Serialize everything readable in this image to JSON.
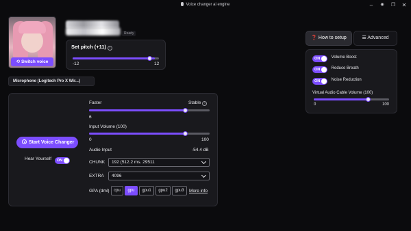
{
  "window": {
    "title": "Voice changer ai engine"
  },
  "avatar": {
    "switch_label": "Switch voice"
  },
  "voice": {
    "status": "Ready"
  },
  "pitch": {
    "label": "Set pitch (+11)",
    "min": "-12",
    "max": "12",
    "value": 11
  },
  "microphone": {
    "value": "Microphone (Logitech Pro X Wir...)"
  },
  "main": {
    "start_label": "Start Voice Changer",
    "hear_yourself_label": "Hear Yourself",
    "hear_yourself_toggle": "ON",
    "faster_label": "Faster",
    "stable_label": "Stable",
    "speed_value": "6",
    "speed_position": 0.7,
    "input_volume_label": "Input Volume (100)",
    "input_volume_min": "0",
    "input_volume_max": "100",
    "input_volume_value": 0.7,
    "audio_input_label": "Audio Input",
    "audio_input_value": "-54.4 dB",
    "chunk_label": "CHUNK",
    "chunk_value": "192 (512.2 ms. 29511",
    "extra_label": "EXTRA",
    "extra_value": "4096",
    "gpa_label": "GPA (dml)",
    "gpu_options": [
      "cpu",
      "gpu",
      "gpu1",
      "gpu2",
      "gpu3"
    ],
    "gpu_selected": "gpu",
    "more_info": "More info"
  },
  "right": {
    "how_to_setup": "How to setup",
    "advanced": "Advanced",
    "options": [
      {
        "toggle": "ON",
        "label": "Volume Boost"
      },
      {
        "toggle": "ON",
        "label": "Reduce Breath"
      },
      {
        "toggle": "ON",
        "label": "Noise Reduction"
      }
    ],
    "cable_volume_label": "Virtual Audio Cable Volume (100)",
    "cable_min": "0",
    "cable_max": "100",
    "cable_value": 0.7
  },
  "colors": {
    "accent": "#7c4dff",
    "background": "#0b0b0d",
    "panel": "#19191d"
  }
}
